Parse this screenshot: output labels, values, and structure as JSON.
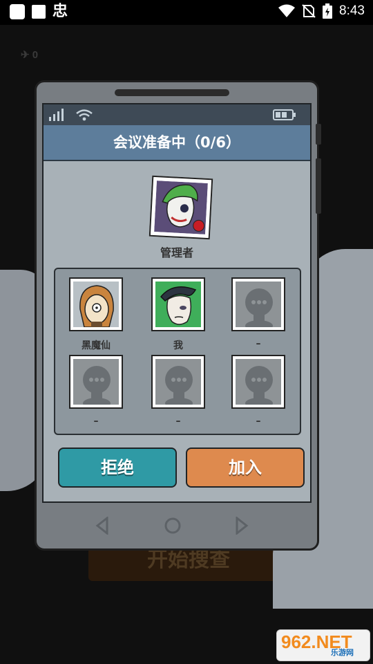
{
  "status_bar": {
    "time": "8:43",
    "app_glyph": "忠"
  },
  "background": {
    "counter": "0",
    "banner_text": "开始搜查"
  },
  "dialog": {
    "title": "会议准备中（0/6）",
    "admin_label": "管理者",
    "slots": [
      {
        "label": "黑魔仙",
        "avatar": "girl-glasses-avatar"
      },
      {
        "label": "我",
        "avatar": "man-suit-avatar"
      },
      {
        "label": "–",
        "avatar": "empty-silhouette"
      },
      {
        "label": "–",
        "avatar": "empty-silhouette"
      },
      {
        "label": "–",
        "avatar": "empty-silhouette"
      },
      {
        "label": "–",
        "avatar": "empty-silhouette"
      }
    ],
    "reject_label": "拒绝",
    "join_label": "加入"
  },
  "watermark": {
    "logo": "962.NET",
    "sub": "乐游网"
  },
  "colors": {
    "title_bar": "#5d7d9b",
    "reject": "#2f9aa5",
    "join": "#de8a4e"
  }
}
